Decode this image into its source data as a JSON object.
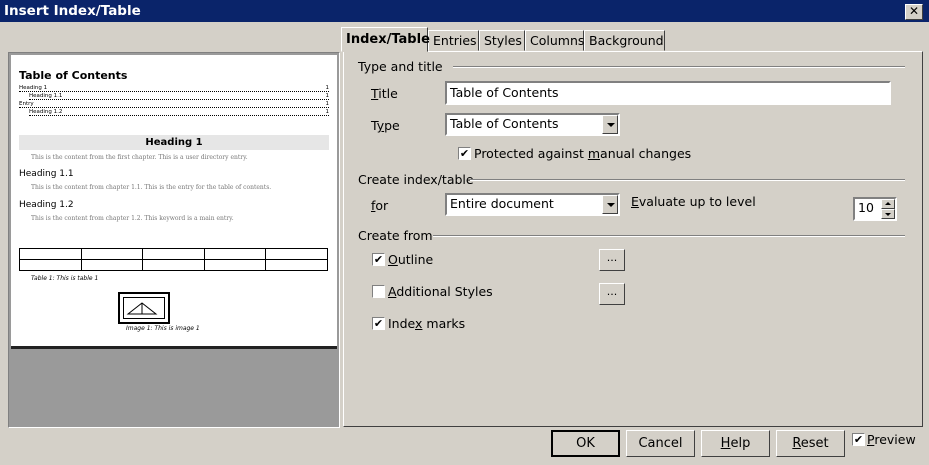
{
  "window": {
    "title": "Insert Index/Table",
    "close_glyph": "✕"
  },
  "preview": {
    "toc_title": "Table of Contents",
    "toc_lines": [
      {
        "text": "Heading 1",
        "page": "1"
      },
      {
        "text": "Heading 1.1",
        "page": "1"
      },
      {
        "text": "Entry",
        "page": "1"
      },
      {
        "text": "Heading 1.2",
        "page": "1"
      }
    ],
    "heading1": "Heading 1",
    "text1": "This is the content from the first chapter. This is a user directory entry.",
    "heading11": "Heading 1.1",
    "text11": "This is the content from chapter 1.1. This is the entry for the table of contents.",
    "heading12": "Heading 1.2",
    "text12": "This is the content from chapter 1.2. This keyword is a main entry.",
    "table_caption": "Table 1: This is table 1",
    "image_caption": "Image 1: This is image 1"
  },
  "tabs": [
    "Index/Table",
    "Entries",
    "Styles",
    "Columns",
    "Background"
  ],
  "active_tab": "Index/Table",
  "type_and_title": {
    "group_label": "Type and title",
    "title_label_u": "T",
    "title_label_rest": "itle",
    "title_value": "Table of Contents",
    "type_label_u": "",
    "type_label_pre": "T",
    "type_label_rest": "pe",
    "type_value": "Table of Contents",
    "protected_pre": "Protected against ",
    "protected_u": "m",
    "protected_post": "anual changes",
    "protected_checked": true
  },
  "create_index": {
    "group_label": "Create index/table",
    "for_label_u": "f",
    "for_label_rest": "or",
    "for_value": "Entire document",
    "evaluate_label_u": "E",
    "evaluate_label_rest": "valuate up to level",
    "level_value": "10"
  },
  "create_from": {
    "group_label": "Create from",
    "outline_label_u": "O",
    "outline_label_rest": "utline",
    "outline_checked": true,
    "additional_label_u": "A",
    "additional_label_rest": "dditional Styles",
    "additional_checked": false,
    "index_marks_pre": "Inde",
    "index_marks_u": "x",
    "index_marks_post": " marks",
    "index_marks_checked": true,
    "browse_glyph": "..."
  },
  "buttons": {
    "ok": "OK",
    "cancel": "Cancel",
    "help_u": "H",
    "help_rest": "elp",
    "reset_u": "R",
    "reset_rest": "eset",
    "preview_u": "P",
    "preview_rest": "review",
    "preview_checked": true
  },
  "check_glyph": "✔",
  "colors": {
    "titlebar": "#0a246a",
    "face": "#d4d0c8"
  }
}
